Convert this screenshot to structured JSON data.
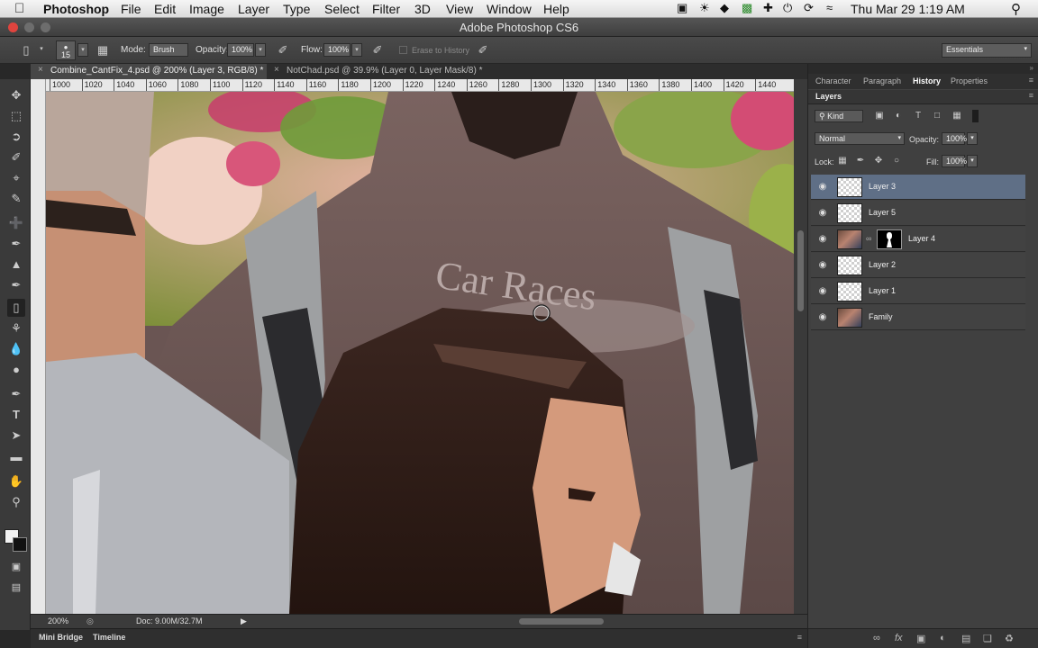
{
  "menubar": {
    "items": [
      "Photoshop",
      "File",
      "Edit",
      "Image",
      "Layer",
      "Type",
      "Select",
      "Filter",
      "3D",
      "View",
      "Window",
      "Help"
    ],
    "clock": "Thu Mar 29  1:19 AM"
  },
  "window": {
    "title": "Adobe Photoshop CS6"
  },
  "options": {
    "brush_size": "15",
    "mode_label": "Mode:",
    "mode_value": "Brush",
    "opacity_label": "Opacity:",
    "opacity_value": "100%",
    "flow_label": "Flow:",
    "flow_value": "100%",
    "erase_history_label": "Erase to History",
    "workspace": "Essentials"
  },
  "tabs": [
    {
      "label": "Combine_CantFix_4.psd @ 200% (Layer 3, RGB/8) *",
      "active": true
    },
    {
      "label": "NotChad.psd @ 39.9% (Layer 0, Layer Mask/8) *",
      "active": false
    }
  ],
  "ruler": {
    "top": [
      "1000",
      "1020",
      "1040",
      "1060",
      "1080",
      "1100",
      "1120",
      "1140",
      "1160",
      "1180",
      "1200",
      "1220",
      "1240",
      "1260",
      "1280",
      "1300",
      "1320",
      "1340",
      "1360",
      "1380",
      "1400",
      "1420",
      "1440"
    ]
  },
  "canvas": {
    "shirt_text": "Car Races"
  },
  "status": {
    "zoom": "200%",
    "doc": "Doc: 9.00M/32.7M"
  },
  "bottom_tabs": [
    "Mini Bridge",
    "Timeline"
  ],
  "panel_tabs": [
    {
      "label": "Character",
      "active": false
    },
    {
      "label": "Paragraph",
      "active": false
    },
    {
      "label": "History",
      "active": true
    },
    {
      "label": "Properties",
      "active": false
    }
  ],
  "layers": {
    "title": "Layers",
    "kind_filter": "Kind",
    "blend_mode": "Normal",
    "opacity_label": "Opacity:",
    "opacity_value": "100%",
    "lock_label": "Lock:",
    "fill_label": "Fill:",
    "fill_value": "100%",
    "items": [
      {
        "name": "Layer 3",
        "selected": true,
        "thumb": "transparent",
        "mask": false
      },
      {
        "name": "Layer 5",
        "selected": false,
        "thumb": "transparent",
        "mask": false
      },
      {
        "name": "Layer 4",
        "selected": false,
        "thumb": "photo",
        "mask": true
      },
      {
        "name": "Layer 2",
        "selected": false,
        "thumb": "transparent",
        "mask": false
      },
      {
        "name": "Layer 1",
        "selected": false,
        "thumb": "transparent",
        "mask": false
      },
      {
        "name": "Family",
        "selected": false,
        "thumb": "photo",
        "mask": false
      }
    ]
  },
  "colors": {
    "selected_layer": "#5f6f86",
    "panel_bg": "#404040",
    "shirt": "#6a5553"
  }
}
